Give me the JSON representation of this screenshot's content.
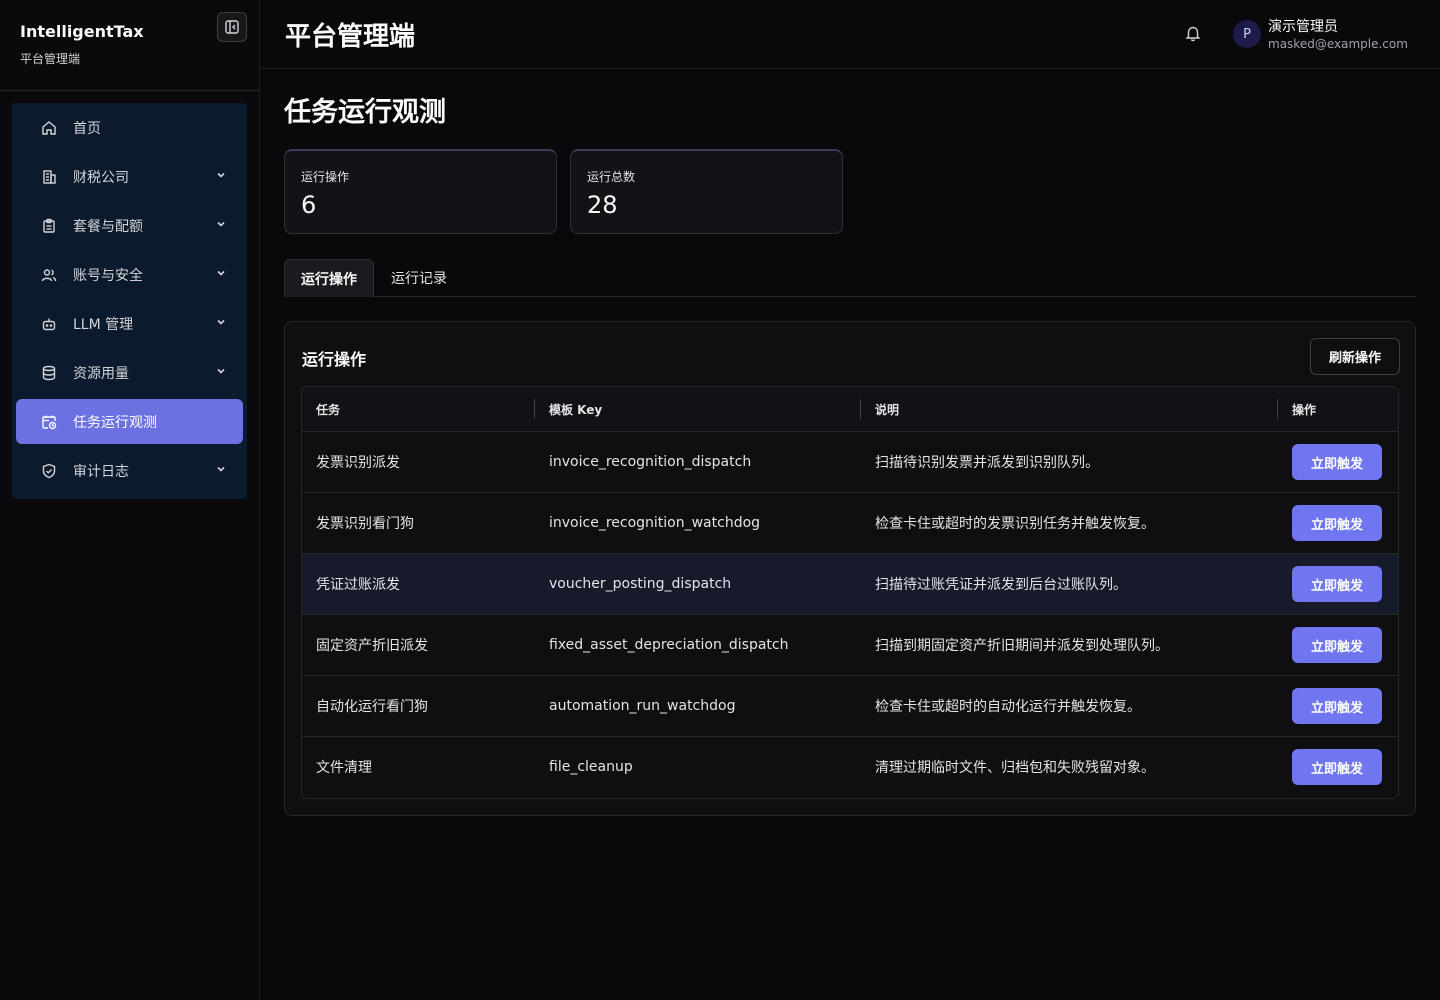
{
  "brand": {
    "title": "IntelligentTax",
    "subtitle": "平台管理端"
  },
  "sidebar": {
    "collapse_icon": "sidebar-collapse-icon",
    "items": [
      {
        "label": "首页",
        "icon": "home-icon",
        "expandable": false,
        "active": false
      },
      {
        "label": "财税公司",
        "icon": "building-icon",
        "expandable": true,
        "active": false
      },
      {
        "label": "套餐与配额",
        "icon": "clipboard-icon",
        "expandable": true,
        "active": false
      },
      {
        "label": "账号与安全",
        "icon": "users-icon",
        "expandable": true,
        "active": false
      },
      {
        "label": "LLM 管理",
        "icon": "bot-icon",
        "expandable": true,
        "active": false
      },
      {
        "label": "资源用量",
        "icon": "database-icon",
        "expandable": true,
        "active": false
      },
      {
        "label": "任务运行观测",
        "icon": "calendar-clock-icon",
        "expandable": false,
        "active": true
      },
      {
        "label": "审计日志",
        "icon": "shield-check-icon",
        "expandable": true,
        "active": false
      }
    ]
  },
  "header": {
    "title": "平台管理端",
    "user": {
      "avatar_letter": "P",
      "name": "演示管理员",
      "email": "masked@example.com"
    }
  },
  "main": {
    "page_title": "任务运行观测",
    "stats": [
      {
        "label": "运行操作",
        "value": "6"
      },
      {
        "label": "运行总数",
        "value": "28"
      }
    ],
    "tabs": [
      {
        "label": "运行操作",
        "active": true
      },
      {
        "label": "运行记录",
        "active": false
      }
    ],
    "panel": {
      "title": "运行操作",
      "refresh_label": "刷新操作",
      "columns": [
        "任务",
        "模板 Key",
        "说明",
        "操作"
      ],
      "rows": [
        {
          "task": "发票识别派发",
          "key": "invoice_recognition_dispatch",
          "desc": "扫描待识别发票并派发到识别队列。",
          "action": "立即触发"
        },
        {
          "task": "发票识别看门狗",
          "key": "invoice_recognition_watchdog",
          "desc": "检查卡住或超时的发票识别任务并触发恢复。",
          "action": "立即触发"
        },
        {
          "task": "凭证过账派发",
          "key": "voucher_posting_dispatch",
          "desc": "扫描待过账凭证并派发到后台过账队列。",
          "action": "立即触发"
        },
        {
          "task": "固定资产折旧派发",
          "key": "fixed_asset_depreciation_dispatch",
          "desc": "扫描到期固定资产折旧期间并派发到处理队列。",
          "action": "立即触发"
        },
        {
          "task": "自动化运行看门狗",
          "key": "automation_run_watchdog",
          "desc": "检查卡住或超时的自动化运行并触发恢复。",
          "action": "立即触发"
        },
        {
          "task": "文件清理",
          "key": "file_cleanup",
          "desc": "清理过期临时文件、归档包和失败残留对象。",
          "action": "立即触发"
        }
      ]
    }
  },
  "colors": {
    "accent": "#6f76f0",
    "active_nav": "#6b71e0",
    "nav_bg": "#0c1a2e",
    "background": "#09090b"
  }
}
